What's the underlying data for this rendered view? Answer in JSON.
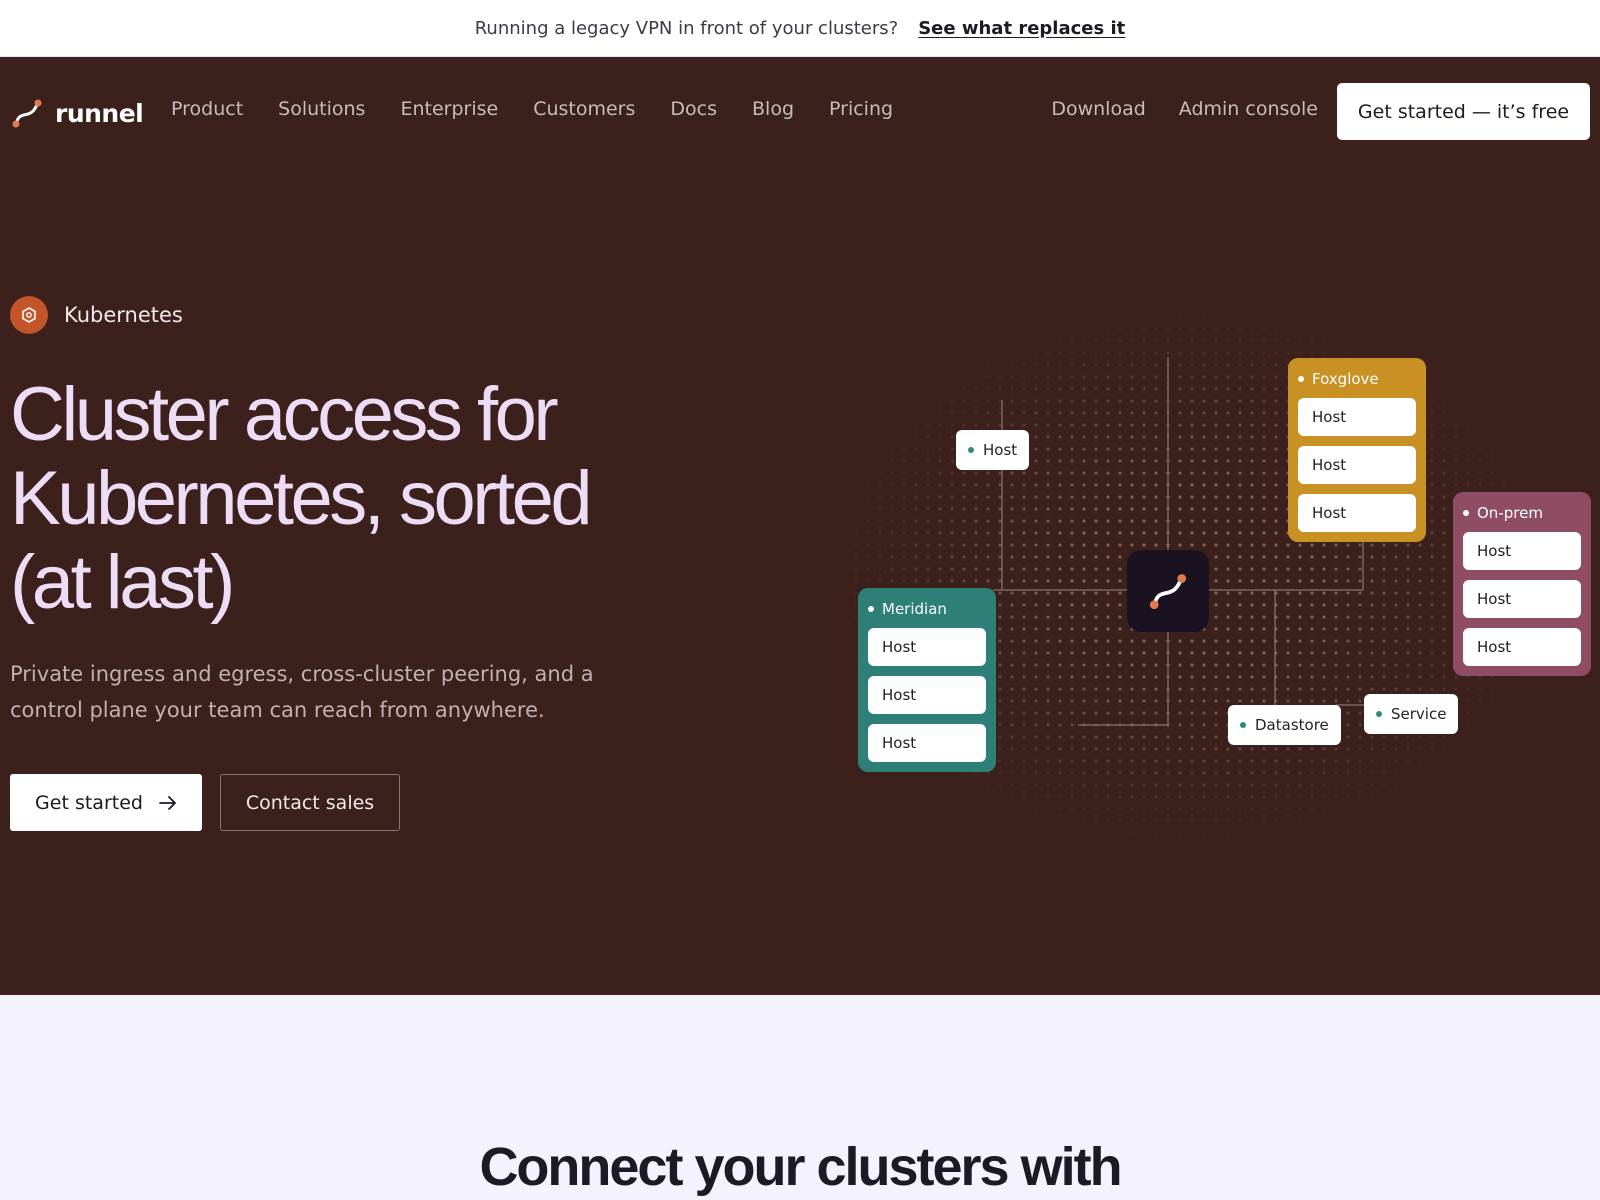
{
  "announcement": {
    "text": "Running a legacy VPN in front of your clusters?",
    "link": "See what replaces it"
  },
  "brand": {
    "name": "runnel",
    "logo_icon": "runnel-logo-icon"
  },
  "nav": {
    "items": [
      "Product",
      "Solutions",
      "Enterprise",
      "Customers",
      "Docs",
      "Blog",
      "Pricing"
    ],
    "right": [
      "Download",
      "Admin console"
    ],
    "cta": "Get started — it’s free"
  },
  "hero": {
    "tag": "Kubernetes",
    "tag_icon": "kubernetes-icon",
    "headline": "Cluster access for Kubernetes, sorted (at last)",
    "subhead": "Private ingress and egress, cross-cluster peering, and a control plane your team can reach from anywhere.",
    "primary_cta": "Get started",
    "secondary_cta": "Contact sales"
  },
  "diagram": {
    "groups": [
      {
        "name": "Foxglove",
        "color": "#c99124",
        "hosts": [
          "Host",
          "Host",
          "Host"
        ]
      },
      {
        "name": "On-prem",
        "color": "#8f4d64",
        "hosts": [
          "Host",
          "Host",
          "Host"
        ]
      },
      {
        "name": "Meridian",
        "color": "#2d7f78",
        "hosts": [
          "Host",
          "Host",
          "Host"
        ]
      }
    ],
    "chips": {
      "host": "Host",
      "datastore": "Datastore",
      "service": "Service"
    },
    "hub_icon": "runnel-logo-icon"
  },
  "colors": {
    "hero_bg": "#3b201c",
    "headline": "#ecdcf6",
    "accent": "#c4542a",
    "page_bg": "#f4f2fc"
  },
  "section": {
    "title": "Connect your clusters with"
  }
}
